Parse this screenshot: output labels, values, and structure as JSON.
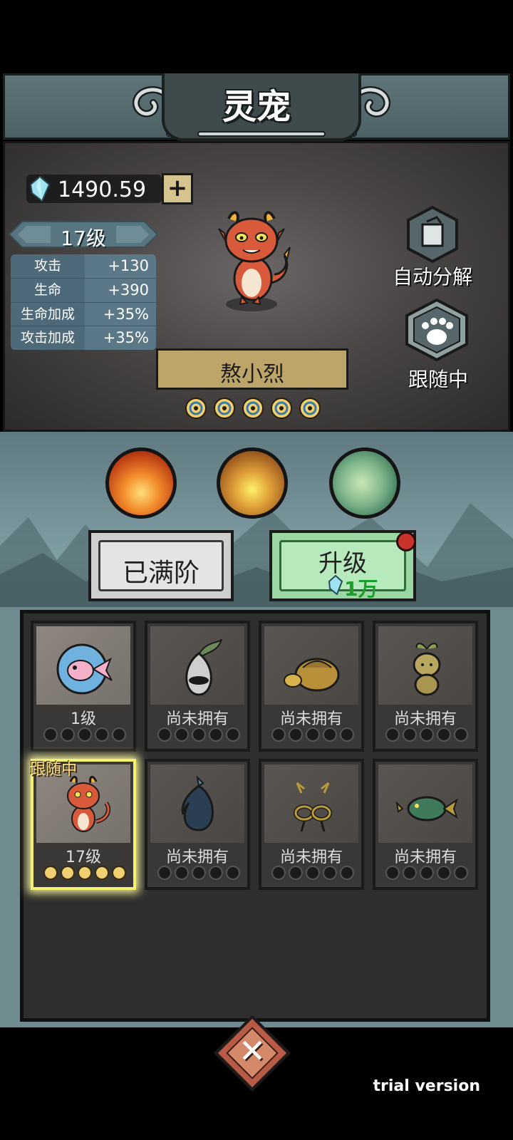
{
  "header": {
    "title": "灵宠"
  },
  "currency": {
    "gem_value": "1490.59",
    "add_label": "+"
  },
  "pet": {
    "level": "17级",
    "name": "熬小烈",
    "stats": [
      {
        "label": "攻击",
        "value": "+130"
      },
      {
        "label": "生命",
        "value": "+390"
      },
      {
        "label": "生命加成",
        "value": "+35%"
      },
      {
        "label": "攻击加成",
        "value": "+35%"
      }
    ],
    "stars_filled": 5,
    "stars_total": 5
  },
  "side": {
    "auto_label": "自动分解",
    "follow_label": "跟随中"
  },
  "elements": [
    "fire-element-icon",
    "earth-element-icon",
    "wind-element-icon"
  ],
  "actions": {
    "maxed_label": "已满阶",
    "upgrade_label": "升级",
    "upgrade_cost": "1万"
  },
  "grid": {
    "follow_tag": "跟随中",
    "cards": [
      {
        "label": "1级",
        "owned": true,
        "icon": "fish-pet-icon"
      },
      {
        "label": "尚未拥有",
        "owned": false,
        "icon": "radish-pet-icon"
      },
      {
        "label": "尚未拥有",
        "owned": false,
        "icon": "turtle-pet-icon"
      },
      {
        "label": "尚未拥有",
        "owned": false,
        "icon": "sprout-pet-icon"
      },
      {
        "label": "17级",
        "owned": true,
        "icon": "dragon-pet-icon"
      },
      {
        "label": "尚未拥有",
        "owned": false,
        "icon": "spirit-pet-icon"
      },
      {
        "label": "尚未拥有",
        "owned": false,
        "icon": "crab-pet-icon"
      },
      {
        "label": "尚未拥有",
        "owned": false,
        "icon": "fish-armor-pet-icon"
      }
    ]
  },
  "footer": {
    "close_label": "✕",
    "trial_text": "trial version"
  },
  "colors": {
    "gem": "#9ee3f0",
    "upgrade_cost": "#1b9e2b",
    "star": "#f0d070",
    "selected": "#f4f070"
  }
}
